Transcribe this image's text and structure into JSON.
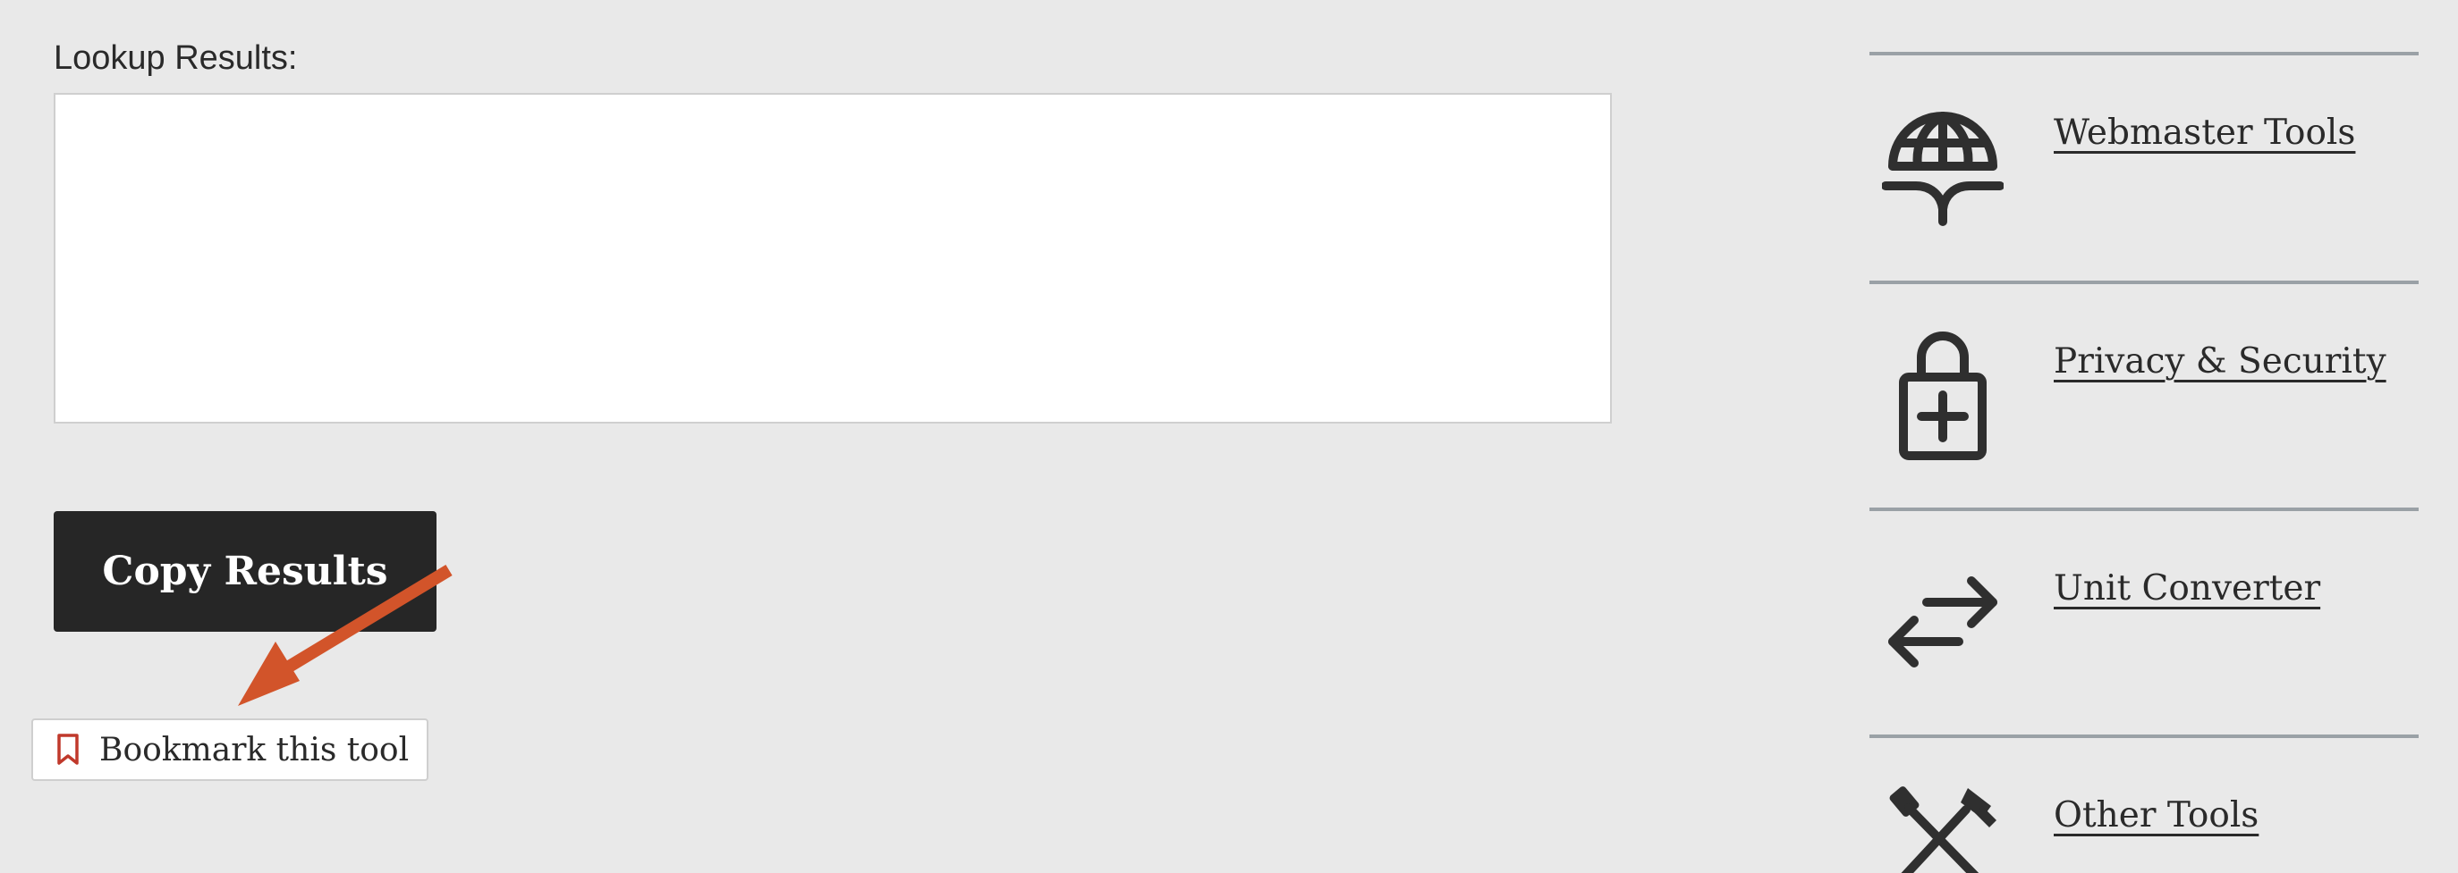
{
  "results": {
    "label": "Lookup Results:",
    "value": ""
  },
  "copy_button": {
    "label": "Copy Results"
  },
  "bookmark_button": {
    "label": "Bookmark this tool",
    "icon": "bookmark-icon"
  },
  "annotation": {
    "arrow_color": "#d2542a"
  },
  "sidebar": {
    "items": [
      {
        "label": "Webmaster Tools",
        "icon": "globe-hand-icon"
      },
      {
        "label": "Privacy & Security",
        "icon": "lock-plus-icon"
      },
      {
        "label": "Unit Converter",
        "icon": "swap-arrows-icon"
      },
      {
        "label": "Other Tools",
        "icon": "tools-icon"
      }
    ]
  },
  "colors": {
    "background": "#e9e9e9",
    "button_dark": "#262626",
    "accent_red": "#c0392b",
    "divider": "#9aa1a6"
  }
}
